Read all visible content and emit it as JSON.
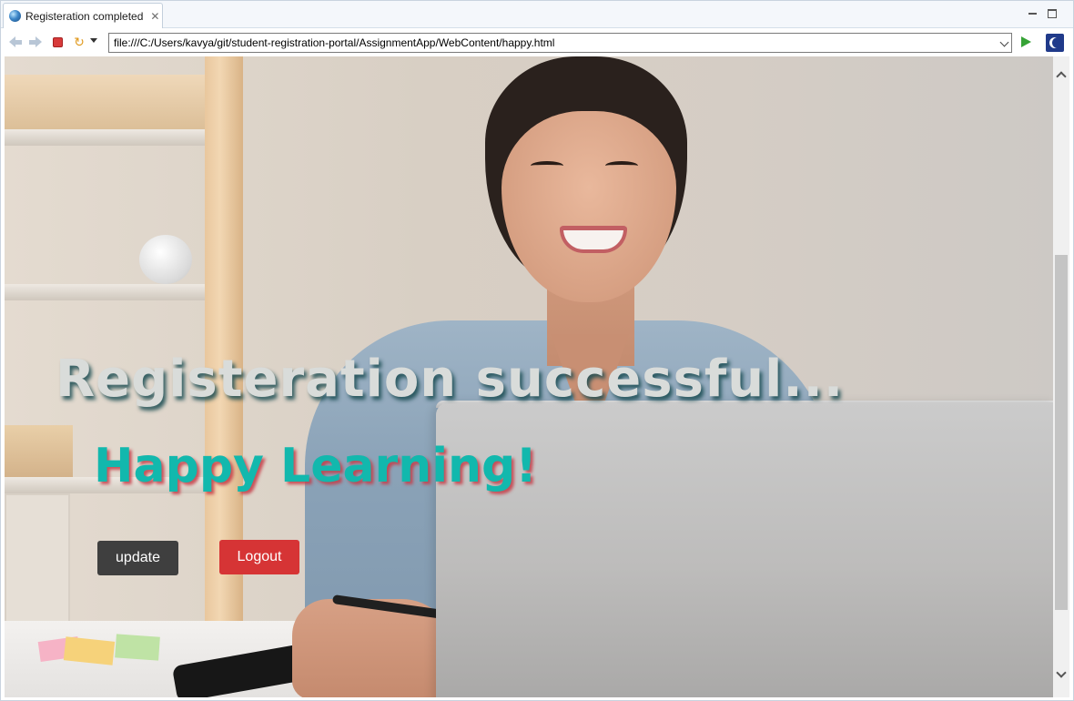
{
  "tab": {
    "title": "Registeration completed",
    "close_glyph": "✕",
    "icon": "globe-icon"
  },
  "window_controls": {
    "minimize_icon": "minimize-icon",
    "maximize_icon": "maximize-icon"
  },
  "toolbar": {
    "back_icon": "back-arrow-icon",
    "forward_icon": "forward-arrow-icon",
    "stop_icon": "stop-icon",
    "refresh_icon": "refresh-icon",
    "refresh_glyph": "↻",
    "url": "file:///C:/Users/kavya/git/student-registration-portal/AssignmentApp/WebContent/happy.html",
    "go_icon": "go-run-icon",
    "external_icon": "eclipse-open-external-icon"
  },
  "page": {
    "heading": "Registeration successful...",
    "subheading": "Happy Learning!",
    "update_label": "update",
    "logout_label": "Logout",
    "colors": {
      "heading": "#d9dcda",
      "subheading": "#12b8ad",
      "update_button": "#3f3f3f",
      "logout_button": "#d63435"
    }
  }
}
